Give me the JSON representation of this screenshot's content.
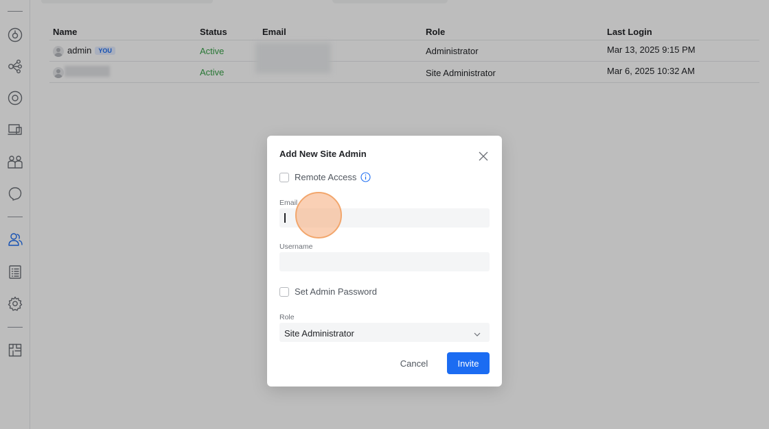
{
  "colors": {
    "accent": "#1b6cf2",
    "active_status": "#38a148",
    "you_badge_bg": "#e4edff",
    "click_indicator": "#f2a66c"
  },
  "sidebar": {
    "icons": [
      "dashboard-icon",
      "topology-icon",
      "devices-icon",
      "client-devices-icon",
      "users-icon",
      "insights-icon",
      "admins-icon",
      "logs-icon",
      "settings-icon",
      "floorplan-icon"
    ],
    "active": "admins-icon"
  },
  "table": {
    "headers": [
      "Name",
      "Status",
      "Email",
      "Role",
      "Last Login"
    ],
    "rows": [
      {
        "name": "admin",
        "badge": "YOU",
        "status": "Active",
        "email": "",
        "role": "Administrator",
        "last_login": "Mar 13, 2025 9:15 PM"
      },
      {
        "name": "",
        "badge": "",
        "status": "Active",
        "email": "",
        "role": "Site Administrator",
        "last_login": "Mar 6, 2025 10:32 AM"
      }
    ]
  },
  "modal": {
    "title": "Add New Site Admin",
    "remote_access_label": "Remote Access",
    "email_label": "Email",
    "email_value": "",
    "username_label": "Username",
    "username_value": "",
    "set_password_label": "Set Admin Password",
    "role_label": "Role",
    "role_value": "Site Administrator",
    "cancel_label": "Cancel",
    "invite_label": "Invite"
  }
}
